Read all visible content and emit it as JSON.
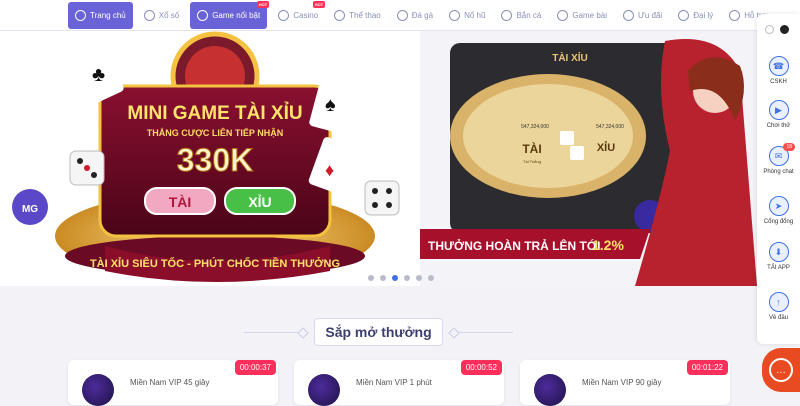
{
  "nav": {
    "items": [
      {
        "label": "Trang chủ",
        "icon": "home-icon",
        "active": true
      },
      {
        "label": "Xổ số",
        "icon": "lottery-icon"
      },
      {
        "label": "Game nổi bật",
        "icon": "game-icon",
        "active": true,
        "badge": "HOT"
      },
      {
        "label": "Casino",
        "icon": "casino-icon",
        "badge": "HOT"
      },
      {
        "label": "Thể thao",
        "icon": "sports-icon"
      },
      {
        "label": "Đá gà",
        "icon": "rooster-icon"
      },
      {
        "label": "Nổ hũ",
        "icon": "slots-icon"
      },
      {
        "label": "Bắn cá",
        "icon": "fish-icon"
      },
      {
        "label": "Game bài",
        "icon": "cards-icon"
      },
      {
        "label": "Ưu đãi",
        "icon": "gift-icon"
      },
      {
        "label": "Đại lý",
        "icon": "agent-icon"
      },
      {
        "label": "Hỗ trợ",
        "icon": "support-icon"
      }
    ]
  },
  "banner_left": {
    "title": "MINI GAME TÀI XỈU",
    "subtitle": "THẮNG CƯỢC LIÊN TIẾP NHẬN",
    "amount": "330K",
    "btn_tai": "TÀI",
    "btn_xiu": "XỈU",
    "tagline": "TÀI XỈU SIÊU TỐC - PHÚT CHỐC TIỀN THƯỞNG"
  },
  "banner_right": {
    "table_title": "TÀI XỈU",
    "left_value": "547,324,000",
    "right_value": "547,324,000",
    "tai": "TÀI",
    "xiu": "XỈU",
    "tai_sub": "Tài Thắng",
    "promo": "THƯỞNG HOÀN TRẢ LÊN TỚI",
    "percent": "1.2%"
  },
  "section": {
    "title": "Sắp mở thưởng"
  },
  "cards": [
    {
      "name": "Miền Nam VIP 45 giây",
      "timer": "00:00:37"
    },
    {
      "name": "Miền Nam VIP 1 phút",
      "timer": "00:00:52"
    },
    {
      "name": "Miền Nam VIP 90 giây",
      "timer": "00:01:22"
    }
  ],
  "side": {
    "items": [
      {
        "label": "CSKH",
        "icon": "headset-icon"
      },
      {
        "label": "Chơi thử",
        "icon": "play-icon"
      },
      {
        "label": "Phòng chat",
        "icon": "chat-icon",
        "badge": "18"
      },
      {
        "label": "Cổng đổng",
        "icon": "send-icon"
      },
      {
        "label": "TẢI APP",
        "icon": "download-icon"
      },
      {
        "label": "Về đầu",
        "icon": "arrow-up-icon"
      }
    ]
  },
  "colors": {
    "accent": "#6a63d8",
    "timer": "#ff2f5b",
    "chat": "#e84a22"
  }
}
